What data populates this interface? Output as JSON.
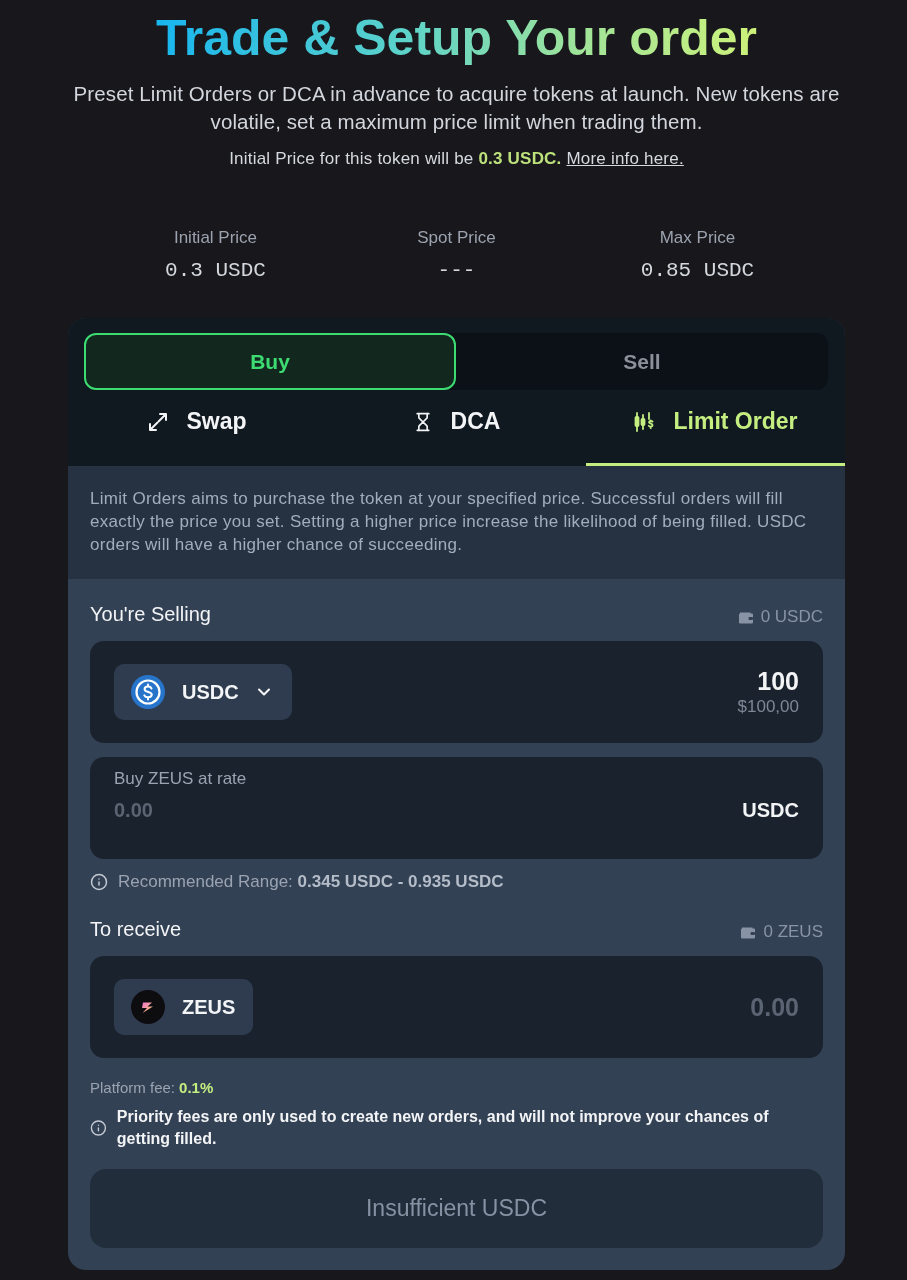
{
  "header": {
    "title": "Trade & Setup Your order",
    "subtitle": "Preset Limit Orders or DCA in advance to acquire tokens at launch. New tokens are volatile, set a maximum price limit when trading them.",
    "price_note": {
      "text": "Initial Price for this token will be",
      "highlight": "0.3 USDC.",
      "link": "More info here."
    }
  },
  "stats": [
    {
      "label": "Initial Price",
      "value": "0.3 USDC"
    },
    {
      "label": "Spot Price",
      "value": "---"
    },
    {
      "label": "Max Price",
      "value": "0.85 USDC"
    }
  ],
  "side_toggle": [
    {
      "label": "Buy",
      "selected": true
    },
    {
      "label": "Sell",
      "selected": false
    }
  ],
  "tabs": [
    {
      "label": "Swap",
      "kind": "swap",
      "selected": false
    },
    {
      "label": "DCA",
      "kind": "dca",
      "selected": false
    },
    {
      "label": "Limit Order",
      "kind": "limit",
      "selected": true
    }
  ],
  "description": "Limit Orders aims to purchase the token at your specified price. Successful orders will fill exactly the price you set. Setting a higher price increase the likelihood of being filled. USDC orders will have a higher chance of succeeding.",
  "selling": {
    "label": "You're Selling",
    "balance": "0 USDC",
    "token": "USDC",
    "amount": "100",
    "amount_usd": "$100,00"
  },
  "rate": {
    "label": "Buy ZEUS at rate",
    "placeholder": "0.00",
    "unit": "USDC"
  },
  "recommended": "Recommended Range: **0.345 USDC - 0.935 USDC**",
  "receiving": {
    "label": "To receive",
    "balance": "0 ZEUS",
    "token": "ZEUS",
    "placeholder": "0.00"
  },
  "platform_fee": {
    "label": "Platform fee:",
    "value": "0.1%"
  },
  "priority_note": "Priority fees are only used to create new orders, and will not improve your chances of getting filled.",
  "submit": {
    "label": "Insufficient USDC",
    "disabled": true
  }
}
